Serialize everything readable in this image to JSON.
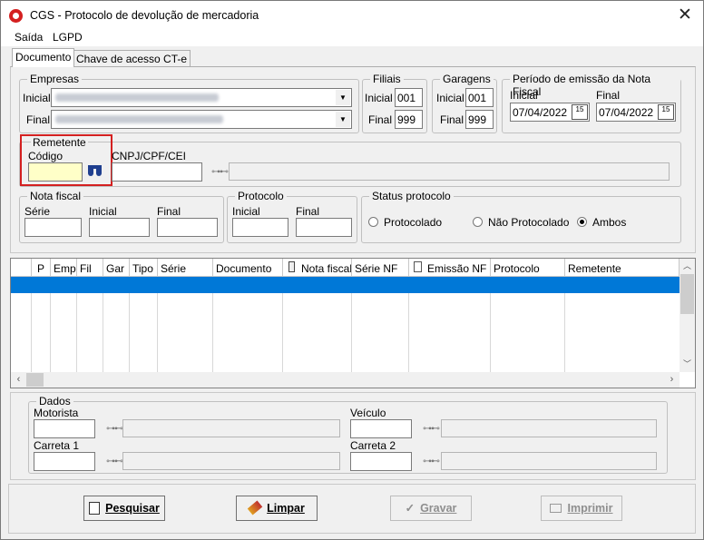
{
  "window": {
    "title": "CGS - Protocolo de devolução de mercadoria",
    "close_glyph": "✕"
  },
  "menu": [
    "Saída",
    "LGPD"
  ],
  "tabs": [
    "Documento",
    "Chave de acesso CT-e"
  ],
  "empresas": {
    "title": "Empresas",
    "inicial_label": "Inicial",
    "final_label": "Final"
  },
  "filiais": {
    "title": "Filiais",
    "inicial_label": "Inicial",
    "inicial_value": "001",
    "final_label": "Final",
    "final_value": "999"
  },
  "garagens": {
    "title": "Garagens",
    "inicial_label": "Inicial",
    "inicial_value": "001",
    "final_label": "Final",
    "final_value": "999"
  },
  "periodo": {
    "title": "Período de emissão da Nota Fiscal",
    "inicial_label": "Inicial",
    "inicial_value": "07/04/2022",
    "final_label": "Final",
    "final_value": "07/04/2022"
  },
  "remetente": {
    "title": "Remetente",
    "codigo_label": "Código",
    "cnpj_label": "CNPJ/CPF/CEI"
  },
  "nota_fiscal": {
    "title": "Nota fiscal",
    "serie_label": "Série",
    "inicial_label": "Inicial",
    "final_label": "Final"
  },
  "protocolo": {
    "title": "Protocolo",
    "inicial_label": "Inicial",
    "final_label": "Final"
  },
  "status": {
    "title": "Status protocolo",
    "options": [
      "Protocolado",
      "Não Protocolado",
      "Ambos"
    ],
    "selected": "Ambos"
  },
  "grid": {
    "columns": [
      "P",
      "Emp",
      "Fil",
      "Gar",
      "Tipo",
      "Série",
      "Documento",
      "Nota fiscal",
      "Série NF",
      "Emissão NF",
      "Protocolo",
      "Remetente"
    ],
    "selected_row_color": "#0078d7"
  },
  "dados": {
    "title": "Dados",
    "motorista_label": "Motorista",
    "veiculo_label": "Veículo",
    "carreta1_label": "Carreta 1",
    "carreta2_label": "Carreta 2"
  },
  "buttons": {
    "pesquisar": "Pesquisar",
    "limpar": "Limpar",
    "gravar": "Gravar",
    "imprimir": "Imprimir"
  },
  "colors": {
    "highlight_border": "#d42020",
    "focus_field": "#ffffc8",
    "selection": "#0078d7"
  }
}
